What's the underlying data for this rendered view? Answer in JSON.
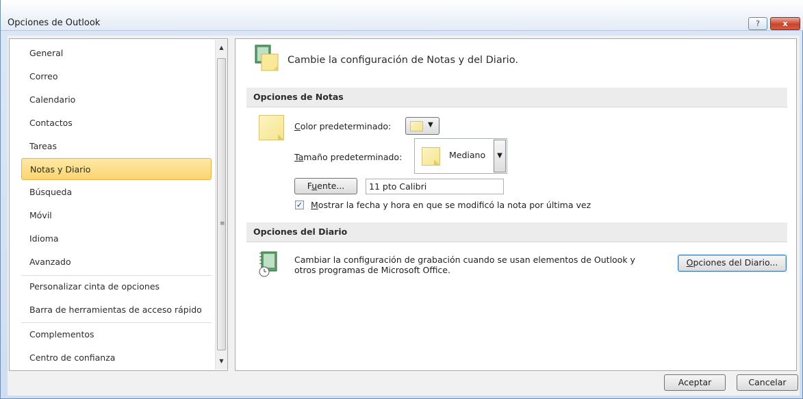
{
  "window": {
    "title": "Opciones de Outlook",
    "help_label": "?",
    "close_label": "x"
  },
  "sidebar": {
    "items": [
      {
        "label": "General"
      },
      {
        "label": "Correo"
      },
      {
        "label": "Calendario"
      },
      {
        "label": "Contactos"
      },
      {
        "label": "Tareas"
      },
      {
        "label": "Notas y Diario",
        "selected": true
      },
      {
        "label": "Búsqueda"
      },
      {
        "label": "Móvil"
      },
      {
        "label": "Idioma"
      },
      {
        "label": "Avanzado"
      },
      {
        "label": "Personalizar cinta de opciones"
      },
      {
        "label": "Barra de herramientas de acceso rápido"
      },
      {
        "label": "Complementos"
      },
      {
        "label": "Centro de confianza"
      }
    ]
  },
  "main": {
    "header": "Cambie la configuración de Notas y del Diario.",
    "notes": {
      "section_title": "Opciones de Notas",
      "color_label_first": "C",
      "color_label_rest": "olor predeterminado:",
      "size_label_first": "T",
      "size_label_mid": "a",
      "size_label_rest": "maño predeterminado:",
      "size_value": "Mediano",
      "font_button_first": "F",
      "font_button_mid": "u",
      "font_button_rest": "ente...",
      "font_value": "11 pto Calibri",
      "show_date_first": "M",
      "show_date_rest": "ostrar la fecha y hora en que se modificó la nota por última vez",
      "show_date_checked": true
    },
    "journal": {
      "section_title": "Opciones del Diario",
      "description_line1": "Cambiar la configuración de grabación cuando se usan elementos de Outlook y",
      "description_line2": "otros programas de Microsoft Office.",
      "button_first": "O",
      "button_rest": "pciones del Diario..."
    }
  },
  "footer": {
    "ok_label": "Aceptar",
    "cancel_label": "Cancelar"
  },
  "colors": {
    "accent_selected": "#fbd571",
    "note_yellow": "#fdf0b0"
  }
}
